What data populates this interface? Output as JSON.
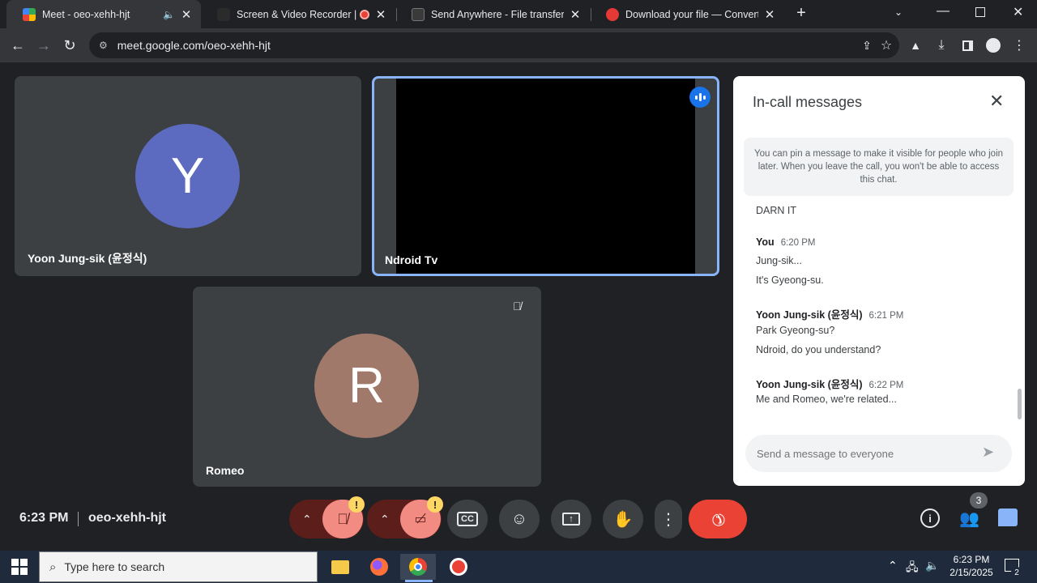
{
  "browser": {
    "tabs": [
      {
        "title": "Meet - oeo-xehh-hjt",
        "active": true
      },
      {
        "title": "Screen & Video Recorder | F",
        "active": false
      },
      {
        "title": "Send Anywhere - File transfer",
        "active": false
      },
      {
        "title": "Download your file — Convertio",
        "active": false
      }
    ],
    "url": "meet.google.com/oeo-xehh-hjt"
  },
  "tiles": [
    {
      "name": "Yoon Jung-sik (윤정식)",
      "initial": "Y",
      "avatar_color": "#5c6bc0"
    },
    {
      "name": "Ndroid Tv"
    },
    {
      "name": "Romeo",
      "initial": "R",
      "avatar_color": "#a1796a"
    }
  ],
  "chat": {
    "title": "In-call messages",
    "pin_notice": "You can pin a message to make it visible for people who join later. When you leave the call, you won't be able to access this chat.",
    "messages": [
      {
        "text": "DARN IT"
      },
      {
        "sender": "You",
        "time": "6:20 PM",
        "lines": [
          "Jung-sik...",
          "It's Gyeong-su."
        ]
      },
      {
        "sender": "Yoon Jung-sik (윤정식)",
        "time": "6:21 PM",
        "lines": [
          "Park Gyeong-su?",
          "Ndroid, do you understand?"
        ]
      },
      {
        "sender": "Yoon Jung-sik (윤정식)",
        "time": "6:22 PM",
        "lines": [
          "Me and Romeo, we're related..."
        ]
      }
    ],
    "input_placeholder": "Send a message to everyone"
  },
  "meeting": {
    "time": "6:23 PM",
    "code": "oeo-xehh-hjt",
    "participant_count": "3"
  },
  "taskbar": {
    "search_placeholder": "Type here to search",
    "clock_time": "6:23 PM",
    "clock_date": "2/15/2025",
    "notification_count": "2"
  },
  "colors": {
    "accent_blue": "#8ab4f8",
    "end_call_red": "#ea4335",
    "muted_bg": "#f28b82"
  }
}
